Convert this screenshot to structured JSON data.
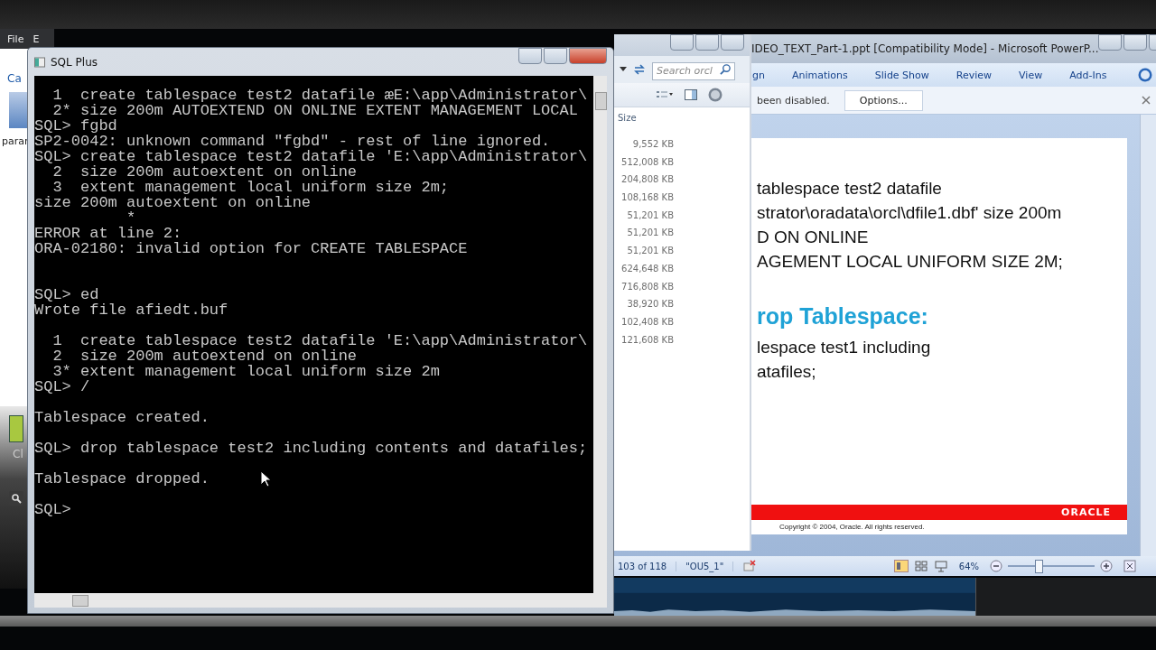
{
  "back_window": {
    "menu": [
      "File",
      "E"
    ],
    "labels": [
      "Ca",
      "parar",
      "Cl"
    ]
  },
  "sqlplus": {
    "title": "SQL Plus",
    "blocks": [
      {
        "kind": "error",
        "lines": [
          "  1  create tablespace test2 datafile æE:\\app\\Administrator\\",
          "  2* size 200m AUTOEXTEND ON ONLINE EXTENT MANAGEMENT LOCAL",
          "SQL> fgbd",
          "SP2-0042: unknown command \"fgbd\" - rest of line ignored.",
          "SQL> create tablespace test2 datafile 'E:\\app\\Administrator\\",
          "  2  size 200m autoextent on online",
          "  3  extent management local uniform size 2m;",
          "size 200m autoextent on online",
          "          *",
          "ERROR at line 2:",
          "ORA-02180: invalid option for CREATE TABLESPACE"
        ]
      },
      {
        "kind": "output",
        "lines": [
          "SQL> ed",
          "Wrote file afiedt.buf"
        ]
      },
      {
        "kind": "output",
        "lines": [
          "  1  create tablespace test2 datafile 'E:\\app\\Administrator\\",
          "  2  size 200m autoextend on online",
          "  3* extent management local uniform size 2m",
          "SQL> /"
        ]
      },
      {
        "kind": "output",
        "lines": [
          "Tablespace created."
        ]
      },
      {
        "kind": "output",
        "lines": [
          "SQL> drop tablespace test2 including contents and datafiles;"
        ]
      },
      {
        "kind": "output",
        "lines": [
          "Tablespace dropped."
        ]
      },
      {
        "kind": "output",
        "lines": [
          "SQL>"
        ]
      }
    ]
  },
  "explorer": {
    "search": {
      "placeholder": "Search orcl"
    },
    "column": "Size",
    "sizes": [
      "9,552 KB",
      "512,008 KB",
      "204,808 KB",
      "108,168 KB",
      "51,201 KB",
      "51,201 KB",
      "51,201 KB",
      "624,648 KB",
      "716,808 KB",
      "38,920 KB",
      "102,408 KB",
      "121,608 KB"
    ]
  },
  "powerpoint": {
    "title": "IDEO_TEXT_Part-1.ppt [Compatibility Mode] - Microsoft PowerP...",
    "ribbon_tabs": [
      {
        "label": "gn",
        "selected": false
      },
      {
        "label": "Animations",
        "selected": false
      },
      {
        "label": "Slide Show",
        "selected": false
      },
      {
        "label": "Review",
        "selected": false
      },
      {
        "label": "View",
        "selected": false
      },
      {
        "label": "Add-Ins",
        "selected": false
      }
    ],
    "message": "been disabled.",
    "options_button": "Options...",
    "slide": {
      "code_lines": [
        "tablespace test2 datafile",
        "strator\\oradata\\orcl\\dfile1.dbf' size 200m",
        "D ON ONLINE",
        "AGEMENT LOCAL UNIFORM SIZE 2M;"
      ],
      "heading": "rop Tablespace:",
      "drop_lines": [
        "lespace test1 including",
        "atafiles;"
      ],
      "brand": "ORACLE",
      "copyright": "Copyright © 2004, Oracle.  All rights reserved."
    },
    "status_bar": {
      "slide": "103 of 118",
      "theme": "\"OU5_1\"",
      "zoom": "64%",
      "level": 0.34
    }
  }
}
